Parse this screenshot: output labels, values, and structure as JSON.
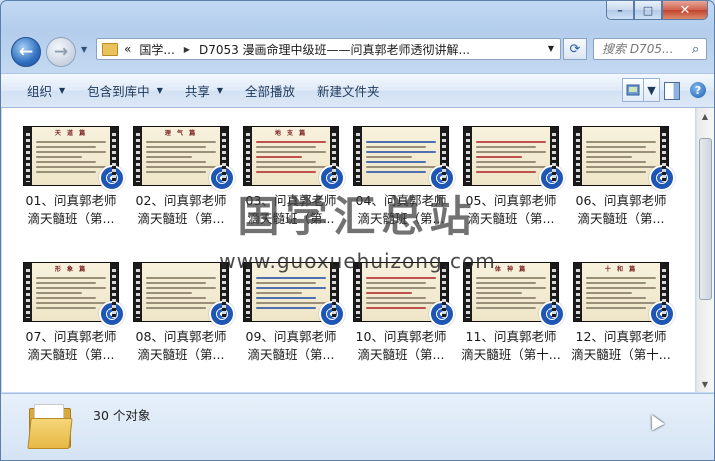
{
  "window": {
    "caption_buttons": {
      "minimize": "–",
      "maximize": "□",
      "close": "✕"
    }
  },
  "nav": {
    "back_glyph": "←",
    "forward_glyph": "→",
    "dropdown_glyph": "▼"
  },
  "address": {
    "prefix": "«",
    "crumb1": "国学...",
    "separator": "▶",
    "crumb2": "D7053  漫画命理中级班——问真郭老师透彻讲解...",
    "dropdown_glyph": "▼",
    "refresh_glyph": "⟳"
  },
  "search": {
    "placeholder": "搜索 D705...",
    "icon": "search-icon",
    "glyph": "⌕"
  },
  "toolbar": {
    "items": [
      {
        "label": "组织",
        "has_arrow": true
      },
      {
        "label": "包含到库中",
        "has_arrow": true
      },
      {
        "label": "共享",
        "has_arrow": true
      },
      {
        "label": "全部播放",
        "has_arrow": false
      },
      {
        "label": "新建文件夹",
        "has_arrow": false
      }
    ],
    "arrow_glyph": "▼",
    "help_glyph": "?"
  },
  "files": [
    {
      "line1": "01、问真郭老师",
      "line2": "滴天髓班（第...",
      "thumb_head": "天 道 篇",
      "style": "plain"
    },
    {
      "line1": "02、问真郭老师",
      "line2": "滴天髓班（第...",
      "thumb_head": "理 气 篇",
      "style": "plain"
    },
    {
      "line1": "03、问真郭老师",
      "line2": "滴天髓班（第...",
      "thumb_head": "地 支 篇",
      "style": "red"
    },
    {
      "line1": "04、问真郭老师",
      "line2": "滴天髓班（第...",
      "thumb_head": "",
      "style": "blue"
    },
    {
      "line1": "05、问真郭老师",
      "line2": "滴天髓班（第...",
      "thumb_head": "",
      "style": "red"
    },
    {
      "line1": "06、问真郭老师",
      "line2": "滴天髓班（第...",
      "thumb_head": "",
      "style": "plain"
    },
    {
      "line1": "07、问真郭老师",
      "line2": "滴天髓班（第...",
      "thumb_head": "形 象 篇",
      "style": "plain"
    },
    {
      "line1": "08、问真郭老师",
      "line2": "滴天髓班（第...",
      "thumb_head": "",
      "style": "plain"
    },
    {
      "line1": "09、问真郭老师",
      "line2": "滴天髓班（第...",
      "thumb_head": "",
      "style": "blue"
    },
    {
      "line1": "10、问真郭老师",
      "line2": "滴天髓班（第...",
      "thumb_head": "",
      "style": "red"
    },
    {
      "line1": "11、问真郭老师",
      "line2": "滴天髓班（第十...",
      "thumb_head": "体 神 篇",
      "style": "plain"
    },
    {
      "line1": "12、问真郭老师",
      "line2": "滴天髓班（第十...",
      "thumb_head": "十 和 篇",
      "style": "plain"
    }
  ],
  "watermark": {
    "title": "国学汇总站",
    "url": "www.guoxuehuizong.com"
  },
  "details": {
    "count_text": "30 个对象"
  },
  "scrollbar": {
    "up_glyph": "▲",
    "down_glyph": "▼"
  }
}
